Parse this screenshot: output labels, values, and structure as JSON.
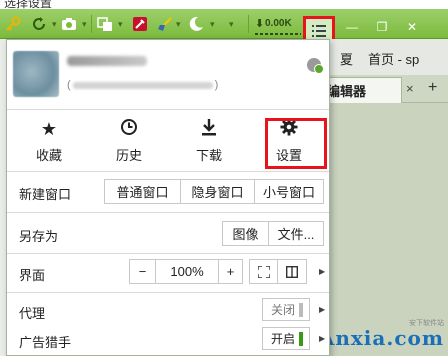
{
  "caption": "选择设置",
  "toolbar": {
    "icons": [
      "key-icon",
      "refresh-icon",
      "camera-icon",
      "translate-icon",
      "tools-icon",
      "broom-icon",
      "moon-icon"
    ],
    "download_speed": "0.00K",
    "menu_icon": "menu-list-icon"
  },
  "background_browser": {
    "bookmarks": [
      "夏",
      "首页 - sp"
    ],
    "tab_title": "编辑器",
    "tab_close": "×",
    "new_tab": "+",
    "watermark": "Anxia.com",
    "watermark_sub": "安下软件站"
  },
  "menu": {
    "account_sub_open": "(",
    "account_sub_close": ")",
    "quick": {
      "favorites": "收藏",
      "history": "历史",
      "download": "下载",
      "settings": "设置"
    },
    "new_window": {
      "label": "新建窗口",
      "normal": "普通窗口",
      "incognito": "隐身窗口",
      "small": "小号窗口"
    },
    "save_as": {
      "label": "另存为",
      "image": "图像",
      "file": "文件..."
    },
    "interface": {
      "label": "界面",
      "minus": "−",
      "zoom": "100%",
      "plus": "+"
    },
    "proxy": {
      "label": "代理",
      "state": "关闭"
    },
    "adblock": {
      "label": "广告猎手",
      "state": "开启"
    }
  },
  "colors": {
    "toolbar": "#8cc552",
    "highlight": "#e8141b",
    "on": "#3a9a1a",
    "watermark": "#1b6fb8"
  }
}
